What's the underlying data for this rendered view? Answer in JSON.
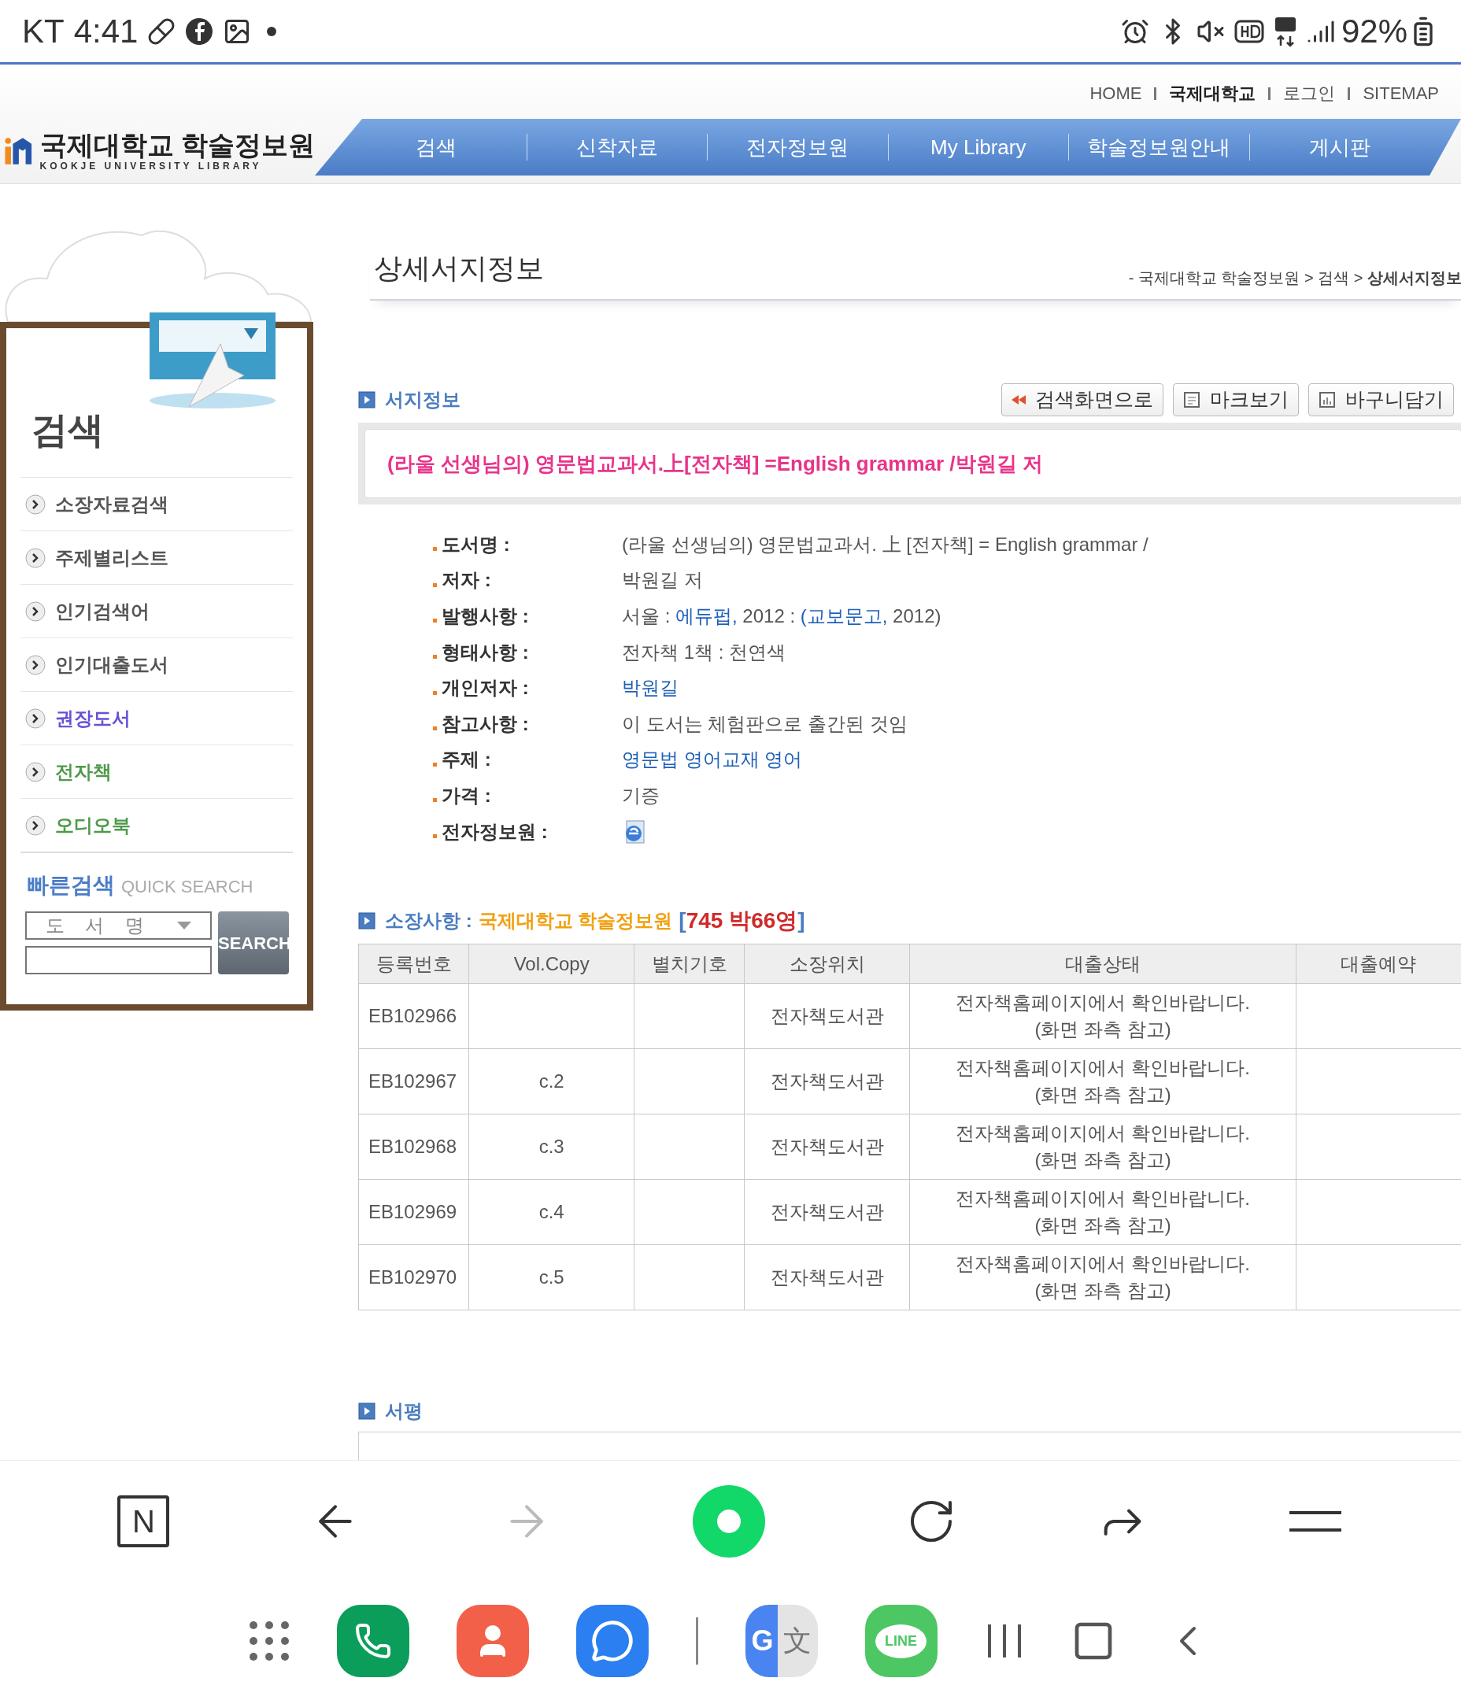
{
  "status_bar": {
    "carrier": "KT",
    "time": "4:41",
    "battery": "92%"
  },
  "top_links": [
    {
      "label": "HOME",
      "selected": false
    },
    {
      "label": "국제대학교",
      "selected": true
    },
    {
      "label": "로그인",
      "selected": false
    },
    {
      "label": "SITEMAP",
      "selected": false
    }
  ],
  "logo": {
    "title": "국제대학교 학술정보원",
    "subtitle": "KOOKJE UNIVERSITY LIBRARY"
  },
  "nav": [
    "검색",
    "신착자료",
    "전자정보원",
    "My Library",
    "학술정보원안내",
    "게시판"
  ],
  "sidebar": {
    "heading": "검색",
    "items": [
      {
        "label": "소장자료검색",
        "color": "#555555"
      },
      {
        "label": "주제별리스트",
        "color": "#555555"
      },
      {
        "label": "인기검색어",
        "color": "#555555"
      },
      {
        "label": "인기대출도서",
        "color": "#555555"
      },
      {
        "label": "권장도서",
        "color": "#6a4fd8"
      },
      {
        "label": "전자책",
        "color": "#4f9a4a"
      },
      {
        "label": "오디오북",
        "color": "#4f9a4a"
      }
    ],
    "quick_search": {
      "title": "빠른검색",
      "subtitle": "QUICK SEARCH",
      "select": "도 서 명",
      "button": "SEARCH"
    }
  },
  "page": {
    "title": "상세서지정보",
    "breadcrumb": "- 국제대학교 학술정보원 > 검색 > **상세서지정보**"
  },
  "bib": {
    "heading": "서지정보",
    "buttons": [
      {
        "label": "검색화면으로",
        "kind": "back"
      },
      {
        "label": "마크보기",
        "kind": "marc"
      },
      {
        "label": "바구니담기",
        "kind": "basket"
      }
    ],
    "title_line": "(라울 선생님의) 영문법교과서.上[전자책] =English grammar /박원길 저",
    "fields": [
      {
        "label": "도서명 :",
        "kind": "text",
        "parts": [
          {
            "text": "(라울 선생님의) 영문법교과서. 上 [전자책] = English grammar /",
            "link": false
          }
        ]
      },
      {
        "label": "저자 :",
        "kind": "text",
        "parts": [
          {
            "text": "박원길 저",
            "link": false
          }
        ]
      },
      {
        "label": "발행사항 :",
        "kind": "text",
        "parts": [
          {
            "text": "서울 : ",
            "link": false
          },
          {
            "text": "에듀펍,",
            "link": true
          },
          {
            "text": " 2012 : ",
            "link": false
          },
          {
            "text": "(교보문고,",
            "link": true
          },
          {
            "text": " 2012)",
            "link": false
          }
        ]
      },
      {
        "label": "형태사항 :",
        "kind": "text",
        "parts": [
          {
            "text": "전자책 1책 : 천연색",
            "link": false
          }
        ]
      },
      {
        "label": "개인저자 :",
        "kind": "text",
        "parts": [
          {
            "text": "박원길",
            "link": true
          }
        ]
      },
      {
        "label": "참고사항 :",
        "kind": "text",
        "parts": [
          {
            "text": "이 도서는 체험판으로 출간된 것임",
            "link": false
          }
        ]
      },
      {
        "label": "주제 :",
        "kind": "text",
        "parts": [
          {
            "text": "영문법 영어교재 영어",
            "link": true
          }
        ]
      },
      {
        "label": "가격 :",
        "kind": "text",
        "parts": [
          {
            "text": "기증",
            "link": false
          }
        ]
      },
      {
        "label": "전자정보원 :",
        "kind": "icon"
      }
    ]
  },
  "holdings": {
    "heading": "소장사항 :",
    "library": "국제대학교 학술정보원",
    "bracket_open": "[",
    "count": "745 박66영",
    "bracket_close": "]",
    "columns": [
      "등록번호",
      "Vol.Copy",
      "별치기호",
      "소장위치",
      "대출상태",
      "대출예약"
    ],
    "rows": [
      {
        "id": "EB102966",
        "location": "전자책도서관",
        "status": [
          "전자책홈페이지에서 확인바랍니다.",
          "(화면 좌측 참고)"
        ]
      },
      {
        "id": "EB102967",
        "vol": "c.2",
        "location": "전자책도서관",
        "status": [
          "전자책홈페이지에서 확인바랍니다.",
          "(화면 좌측 참고)"
        ]
      },
      {
        "id": "EB102968",
        "vol": "c.3",
        "location": "전자책도서관",
        "status": [
          "전자책홈페이지에서 확인바랍니다.",
          "(화면 좌측 참고)"
        ]
      },
      {
        "id": "EB102969",
        "vol": "c.4",
        "location": "전자책도서관",
        "status": [
          "전자책홈페이지에서 확인바랍니다.",
          "(화면 좌측 참고)"
        ]
      },
      {
        "id": "EB102970",
        "vol": "c.5",
        "location": "전자책도서관",
        "status": [
          "전자책홈페이지에서 확인바랍니다.",
          "(화면 좌측 참고)"
        ]
      }
    ]
  },
  "review": {
    "heading": "서평"
  },
  "browser_toolbar": {
    "home_label": "N"
  },
  "dock": {
    "translate_label": "G",
    "translate_glyph": "文",
    "line_label": "LINE"
  }
}
